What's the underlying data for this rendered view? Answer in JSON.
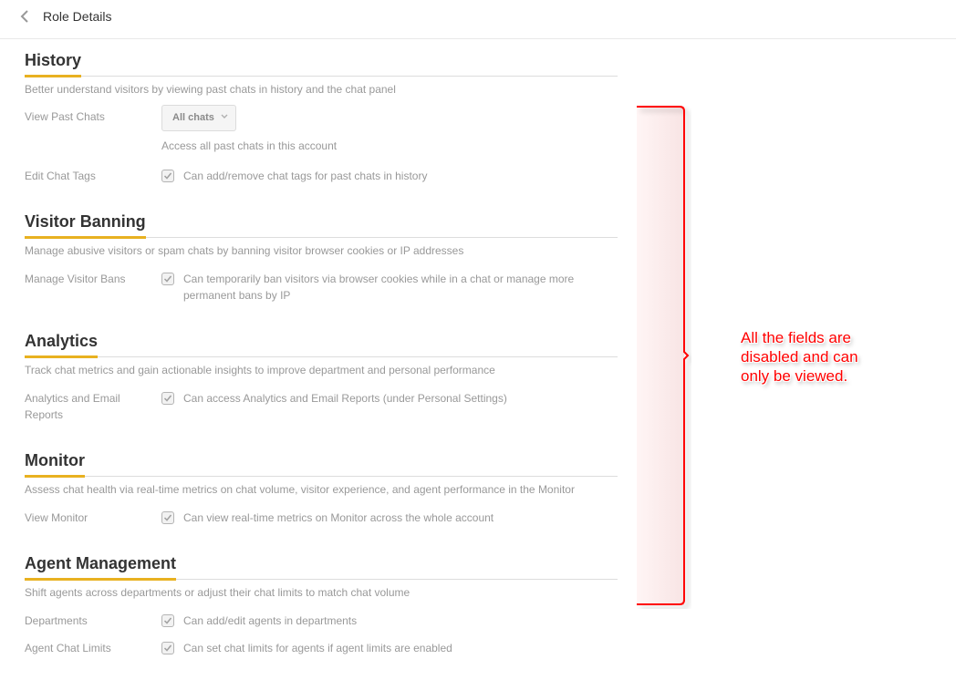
{
  "header": {
    "back_icon": "chevron-left-icon",
    "title": "Role Details"
  },
  "colors": {
    "accent": "#e8b120",
    "annotation": "#ff0000",
    "muted_text": "#999999",
    "heading": "#333333"
  },
  "sections": [
    {
      "title": "History",
      "description": "Better understand visitors by viewing past chats in history and the chat panel",
      "rows": [
        {
          "label": "View Past Chats",
          "type": "select",
          "value": "All chats",
          "help": "Access all past chats in this account",
          "disabled": true
        },
        {
          "label": "Edit Chat Tags",
          "type": "checkbox",
          "checked": true,
          "text": "Can add/remove chat tags for past chats in history",
          "disabled": true
        }
      ]
    },
    {
      "title": "Visitor Banning",
      "description": "Manage abusive visitors or spam chats by banning visitor browser cookies or IP addresses",
      "rows": [
        {
          "label": "Manage Visitor Bans",
          "type": "checkbox",
          "checked": true,
          "text": "Can temporarily ban visitors via browser cookies while in a chat or manage more permanent bans by IP",
          "disabled": true
        }
      ]
    },
    {
      "title": "Analytics",
      "description": "Track chat metrics and gain actionable insights to improve department and personal performance",
      "rows": [
        {
          "label": "Analytics and Email Reports",
          "type": "checkbox",
          "checked": true,
          "text": "Can access Analytics and Email Reports (under Personal Settings)",
          "disabled": true
        }
      ]
    },
    {
      "title": "Monitor",
      "description": "Assess chat health via real-time metrics on chat volume, visitor experience, and agent performance in the Monitor",
      "rows": [
        {
          "label": "View Monitor",
          "type": "checkbox",
          "checked": true,
          "text": "Can view real-time metrics on Monitor across the whole account",
          "disabled": true
        }
      ]
    },
    {
      "title": "Agent Management",
      "description": "Shift agents across departments or adjust their chat limits to match chat volume",
      "rows": [
        {
          "label": "Departments",
          "type": "checkbox",
          "checked": true,
          "text": "Can add/edit agents in departments",
          "disabled": true
        },
        {
          "label": "Agent Chat Limits",
          "type": "checkbox",
          "checked": true,
          "text": "Can set chat limits for agents if agent limits are enabled",
          "disabled": true
        }
      ]
    }
  ],
  "annotation": {
    "text": "All the fields are\ndisabled and can\nonly be viewed."
  }
}
